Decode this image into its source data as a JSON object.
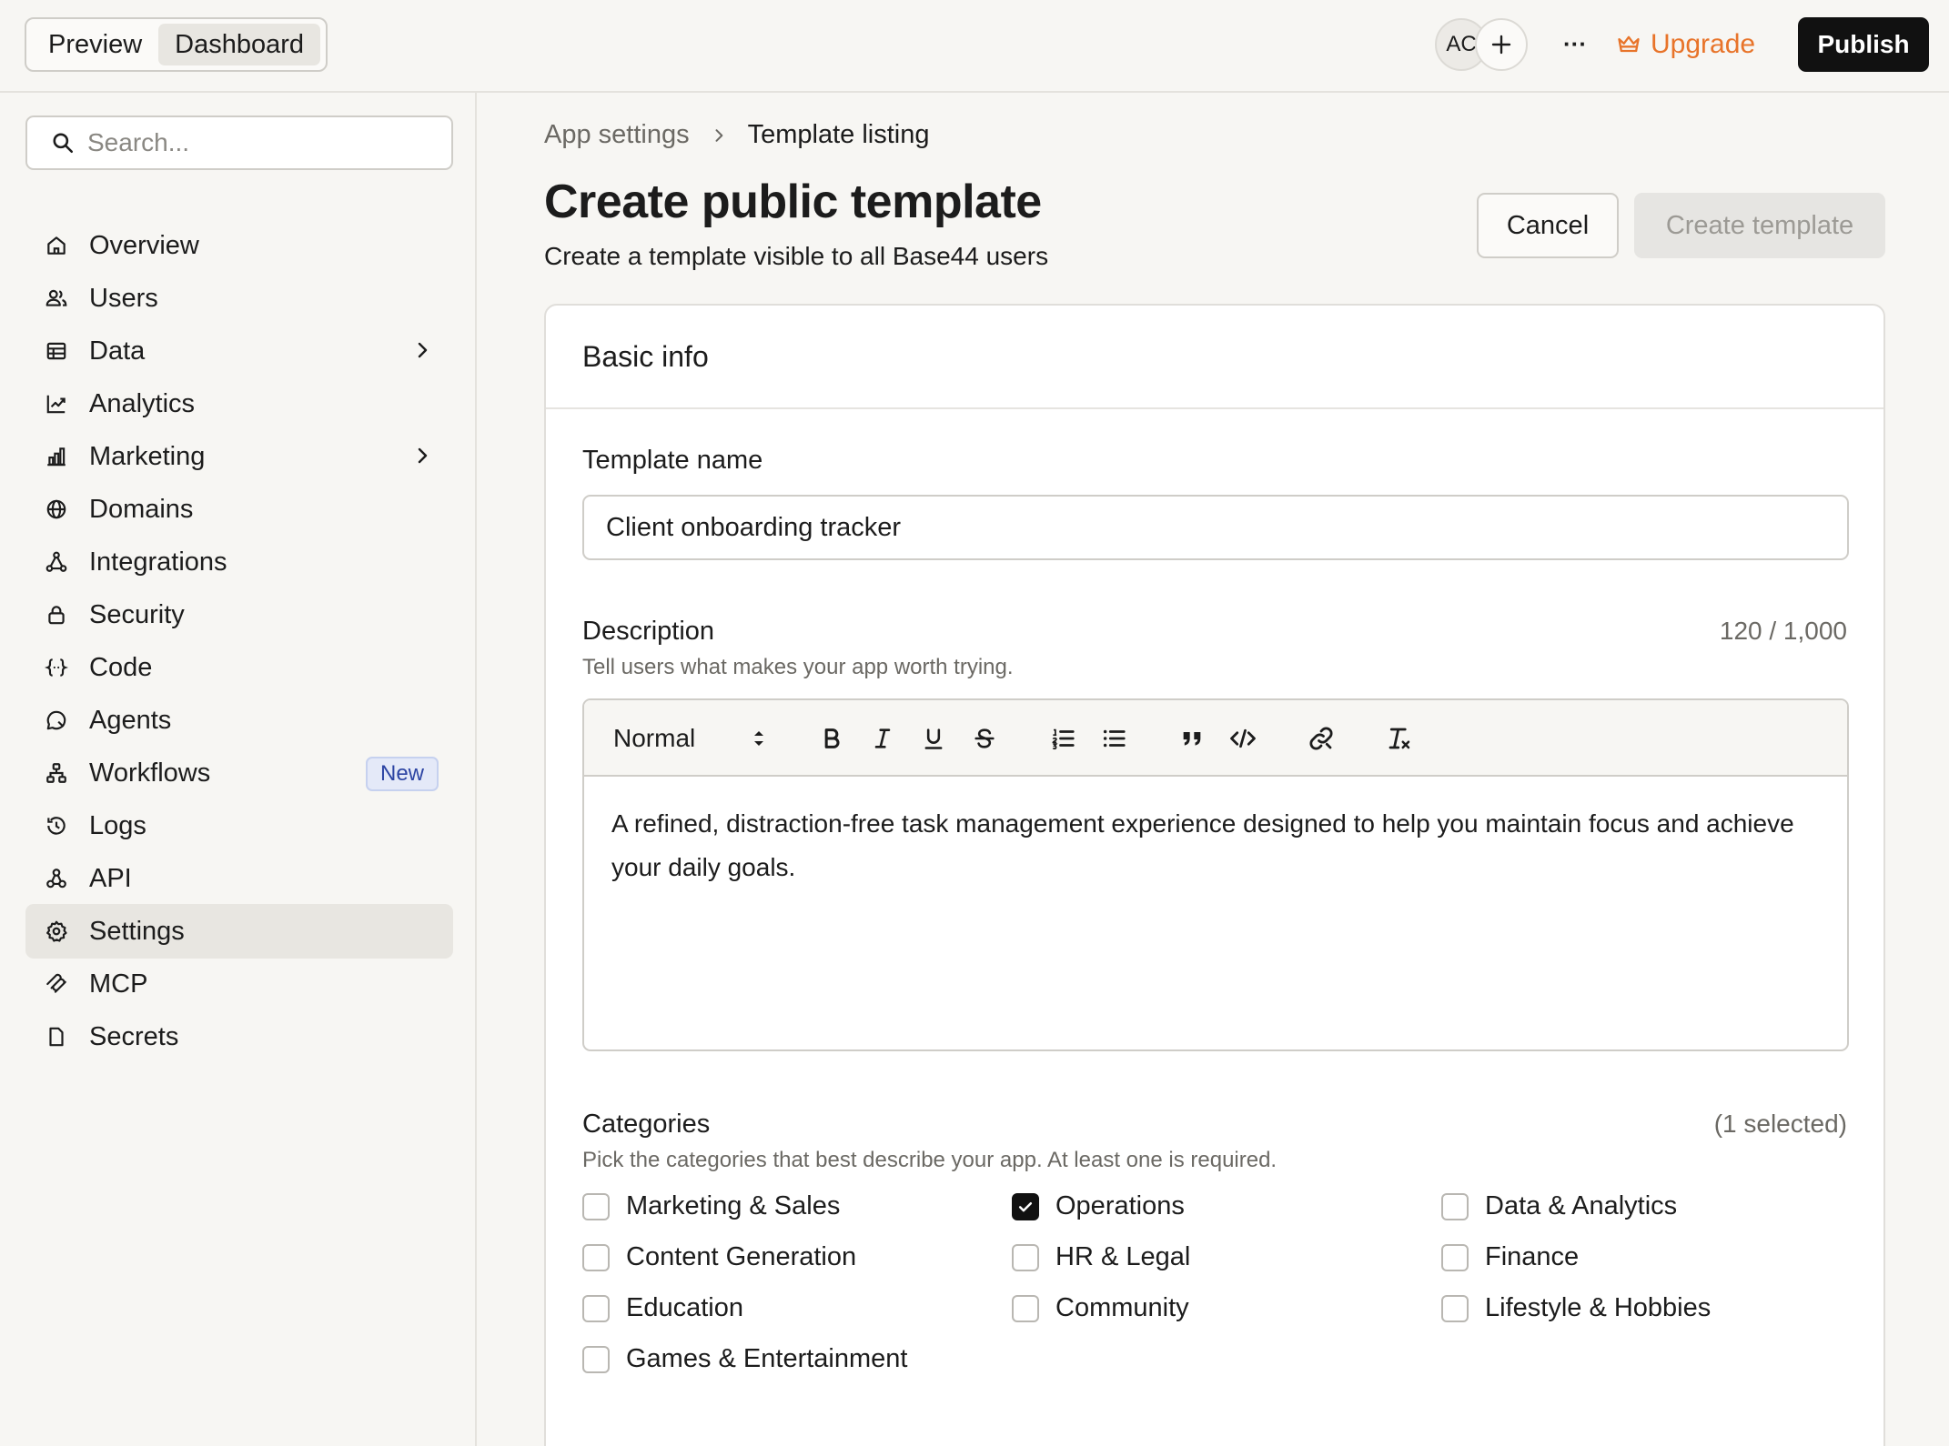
{
  "topbar": {
    "modes": [
      "Preview",
      "Dashboard"
    ],
    "active_mode": "Dashboard",
    "avatar_initials": "AC",
    "more_label": "···",
    "upgrade_label": "Upgrade",
    "publish_label": "Publish",
    "accent_upgrade": "#e8742a"
  },
  "sidebar": {
    "search_placeholder": "Search...",
    "items": [
      {
        "label": "Overview",
        "icon": "home-icon"
      },
      {
        "label": "Users",
        "icon": "users-icon"
      },
      {
        "label": "Data",
        "icon": "table-icon",
        "chevron": true
      },
      {
        "label": "Analytics",
        "icon": "chart-line-icon"
      },
      {
        "label": "Marketing",
        "icon": "bar-chart-icon",
        "chevron": true
      },
      {
        "label": "Domains",
        "icon": "globe-icon"
      },
      {
        "label": "Integrations",
        "icon": "integrations-icon"
      },
      {
        "label": "Security",
        "icon": "lock-icon"
      },
      {
        "label": "Code",
        "icon": "code-braces-icon"
      },
      {
        "label": "Agents",
        "icon": "agent-icon"
      },
      {
        "label": "Workflows",
        "icon": "workflow-icon",
        "badge": "New"
      },
      {
        "label": "Logs",
        "icon": "history-icon"
      },
      {
        "label": "API",
        "icon": "api-icon"
      },
      {
        "label": "Settings",
        "icon": "gear-icon",
        "active": true
      },
      {
        "label": "MCP",
        "icon": "mcp-icon"
      },
      {
        "label": "Secrets",
        "icon": "file-icon"
      }
    ]
  },
  "main": {
    "breadcrumb": {
      "parent": "App settings",
      "current": "Template listing"
    },
    "title": "Create public template",
    "subtitle": "Create a template visible to all Base44 users",
    "cancel_label": "Cancel",
    "create_label": "Create template",
    "card": {
      "header": "Basic info",
      "template_name": {
        "label": "Template name",
        "value": "Client onboarding tracker"
      },
      "description": {
        "label": "Description",
        "help": "Tell users what makes your app worth trying.",
        "count": "120 / 1,000",
        "format": "Normal",
        "text": "A refined, distraction-free task management experience designed to help you maintain focus and achieve your daily goals."
      },
      "categories": {
        "label": "Categories",
        "help": "Pick the categories that best describe your app. At least one is required.",
        "selected_count": "(1 selected)",
        "items": [
          {
            "label": "Marketing & Sales",
            "checked": false
          },
          {
            "label": "Operations",
            "checked": true
          },
          {
            "label": "Data & Analytics",
            "checked": false
          },
          {
            "label": "Content Generation",
            "checked": false
          },
          {
            "label": "HR & Legal",
            "checked": false
          },
          {
            "label": "Finance",
            "checked": false
          },
          {
            "label": "Education",
            "checked": false
          },
          {
            "label": "Community",
            "checked": false
          },
          {
            "label": "Lifestyle & Hobbies",
            "checked": false
          },
          {
            "label": "Games & Entertainment",
            "checked": false
          }
        ]
      }
    }
  }
}
